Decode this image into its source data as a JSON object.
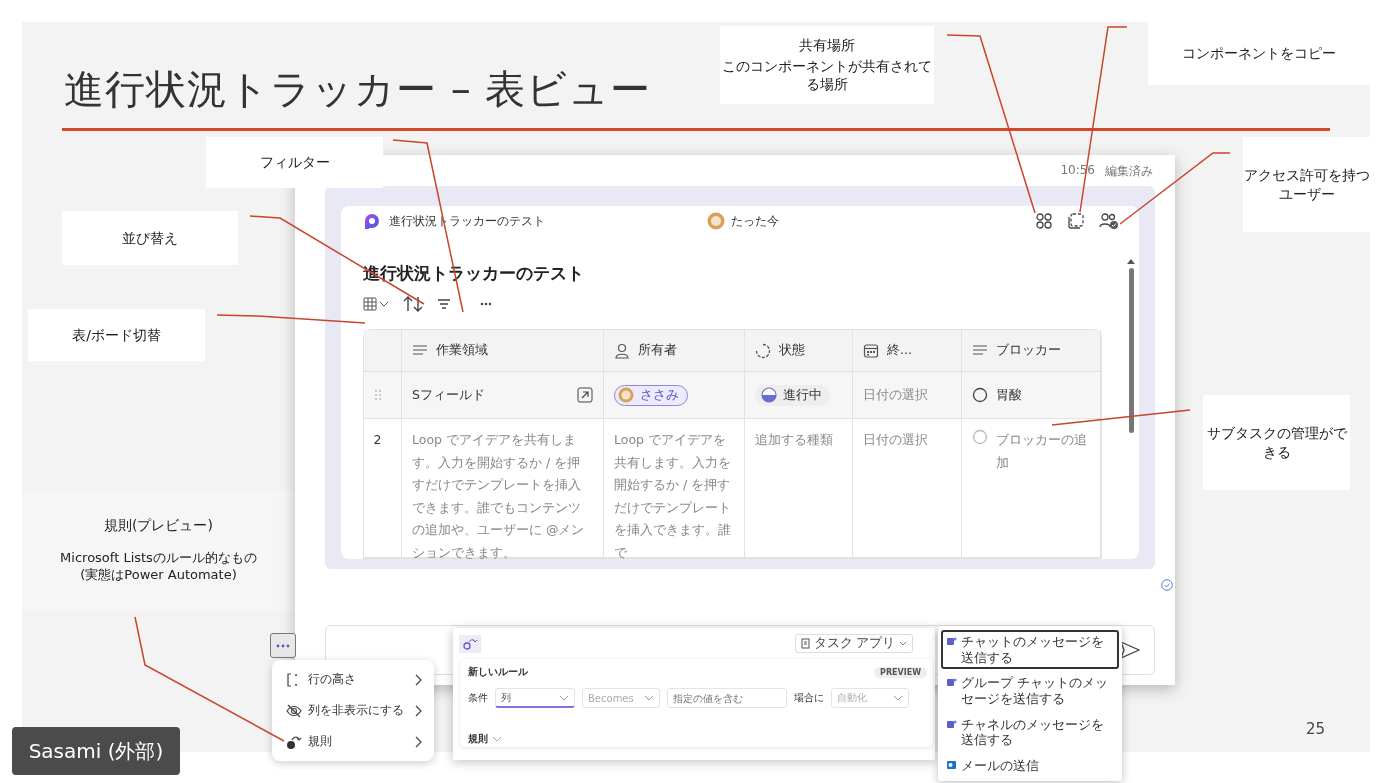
{
  "slide": {
    "title": "進行状況トラッカー – 表ビュー",
    "page_number": "25"
  },
  "callouts": [
    {
      "kind": "shared",
      "heading": "共有場所",
      "body": "このコンポーネントが共有されてる場所"
    },
    {
      "kind": "copy",
      "body": "コンポーネントをコピー"
    },
    {
      "kind": "filter",
      "body": "フィルター"
    },
    {
      "kind": "sort",
      "body": "並び替え"
    },
    {
      "kind": "access",
      "body": "アクセス許可を持つユーザー"
    },
    {
      "kind": "switch",
      "body": "表/ボード切替"
    },
    {
      "kind": "subtask",
      "body": "サブタスクの管理ができる"
    },
    {
      "kind": "rule",
      "heading": "規則(プレビュー)",
      "body": "Microsoft Listsのルール的なもの\n(実態はPower Automate)"
    }
  ],
  "app": {
    "time": "10:56",
    "edit_status": "編集済み",
    "component_name": "進行状況トラッカーのテスト",
    "activity": "たった今",
    "heading": "進行状況トラッカーのテスト"
  },
  "table": {
    "columns": [
      {
        "label": "作業領域",
        "kind": "text"
      },
      {
        "label": "所有者",
        "kind": "person"
      },
      {
        "label": "状態",
        "kind": "status"
      },
      {
        "label": "終...",
        "kind": "date"
      },
      {
        "label": "ブロッカー",
        "kind": "text"
      }
    ],
    "rows": [
      {
        "number": "",
        "cells": [
          {
            "kind": "title",
            "text": "Sフィールド"
          },
          {
            "kind": "person",
            "text": "ささみ"
          },
          {
            "kind": "status",
            "text": "進行中"
          },
          {
            "kind": "plain",
            "text": "日付の選択",
            "placeholder": true
          },
          {
            "kind": "check",
            "text": "胃酸",
            "checked": false,
            "placeholder": false
          }
        ]
      },
      {
        "number": "2",
        "cells": [
          {
            "kind": "plain",
            "text": "Loop でアイデアを共有します。入力を開始するか / を押すだけでテンプレートを挿入できます。誰でもコンテンツの追加や、ユーザーに @メンションできます。",
            "placeholder": true
          },
          {
            "kind": "plain",
            "text": "Loop でアイデアを共有します。入力を開始するか / を押すだけでテンプレートを挿入できます。誰で",
            "placeholder": true
          },
          {
            "kind": "plain",
            "text": "追加する種類",
            "placeholder": true
          },
          {
            "kind": "plain",
            "text": "日付の選択",
            "placeholder": true
          },
          {
            "kind": "check",
            "text": "ブロッカーの追加",
            "checked": false,
            "placeholder": true
          }
        ]
      }
    ]
  },
  "more_menu": {
    "items": [
      {
        "label": "行の高さ",
        "kind": "height"
      },
      {
        "label": "列を非表示にする",
        "kind": "hide"
      },
      {
        "label": "規則",
        "kind": "rule"
      }
    ]
  },
  "rule_panel": {
    "app_button": "タスク アプリ",
    "title": "新しいルール",
    "badge": "PREVIEW",
    "condition_label": "条件",
    "column_field": "列",
    "operator_field": "Becomes",
    "value_placeholder": "指定の値を含む",
    "when_label": "場合に",
    "action_field": "自動化",
    "rules_label": "規則"
  },
  "action_menu": {
    "items": [
      {
        "label": "チャットのメッセージを送信する",
        "kind": "teams",
        "selected": true
      },
      {
        "label": "グループ チャットのメッセージを送信する",
        "kind": "teams",
        "selected": false
      },
      {
        "label": "チャネルのメッセージを送信する",
        "kind": "teams",
        "selected": false
      },
      {
        "label": "メールの送信",
        "kind": "mail",
        "selected": false
      }
    ]
  },
  "participant": {
    "name": "Sasami (外部)"
  }
}
